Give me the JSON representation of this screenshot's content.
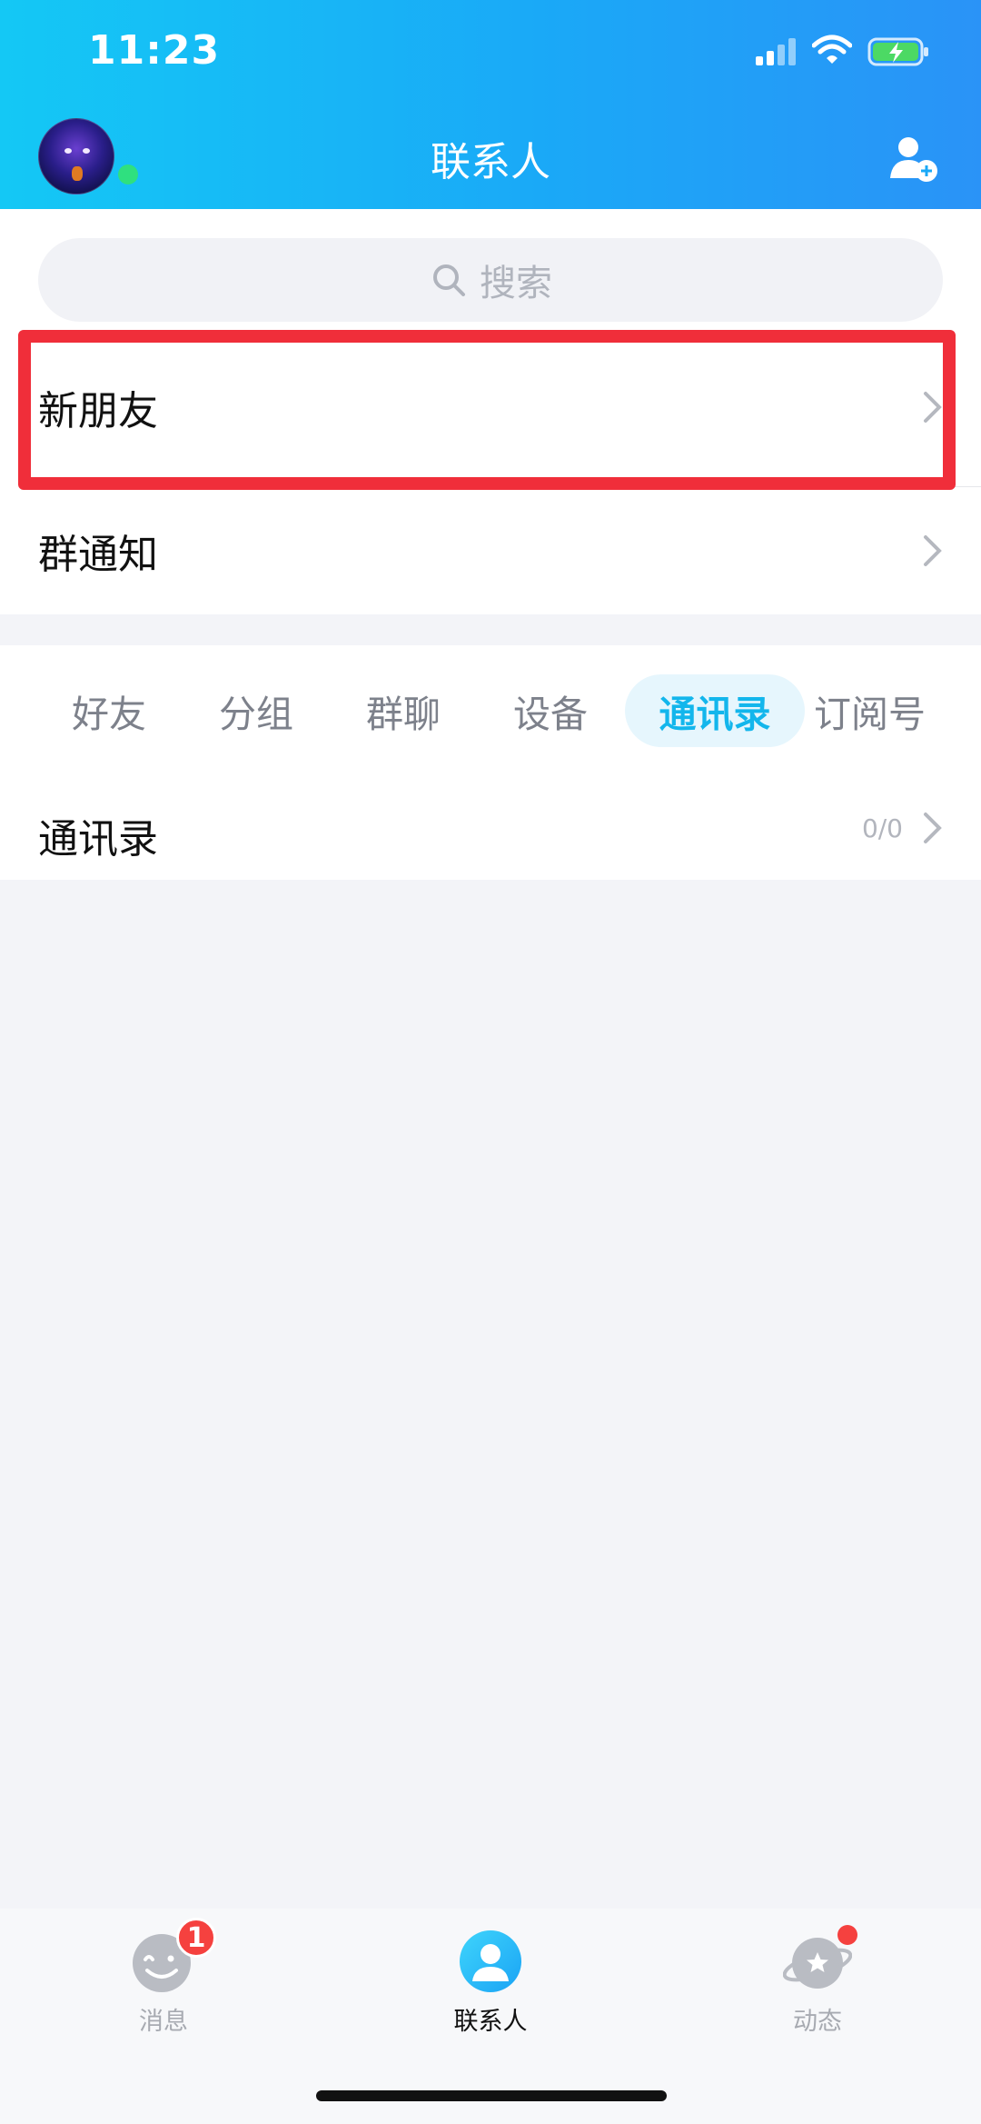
{
  "status_bar": {
    "time": "11:23"
  },
  "header": {
    "title": "联系人"
  },
  "search": {
    "placeholder": "搜索"
  },
  "rows": {
    "new_friends": "新朋友",
    "group_notice": "群通知"
  },
  "tabs": [
    {
      "label": "好友"
    },
    {
      "label": "分组"
    },
    {
      "label": "群聊"
    },
    {
      "label": "设备"
    },
    {
      "label": "通讯录",
      "active": true
    },
    {
      "label": "订阅号"
    }
  ],
  "contacts_row": {
    "label": "通讯录",
    "count": "0/0"
  },
  "tabbar": {
    "messages": {
      "label": "消息",
      "badge": "1"
    },
    "contacts": {
      "label": "联系人"
    },
    "feeds": {
      "label": "动态"
    }
  },
  "colors": {
    "accent": "#13b6ec",
    "highlight": "#f02e3a",
    "badge": "#f5413f",
    "online": "#2fe07f"
  }
}
